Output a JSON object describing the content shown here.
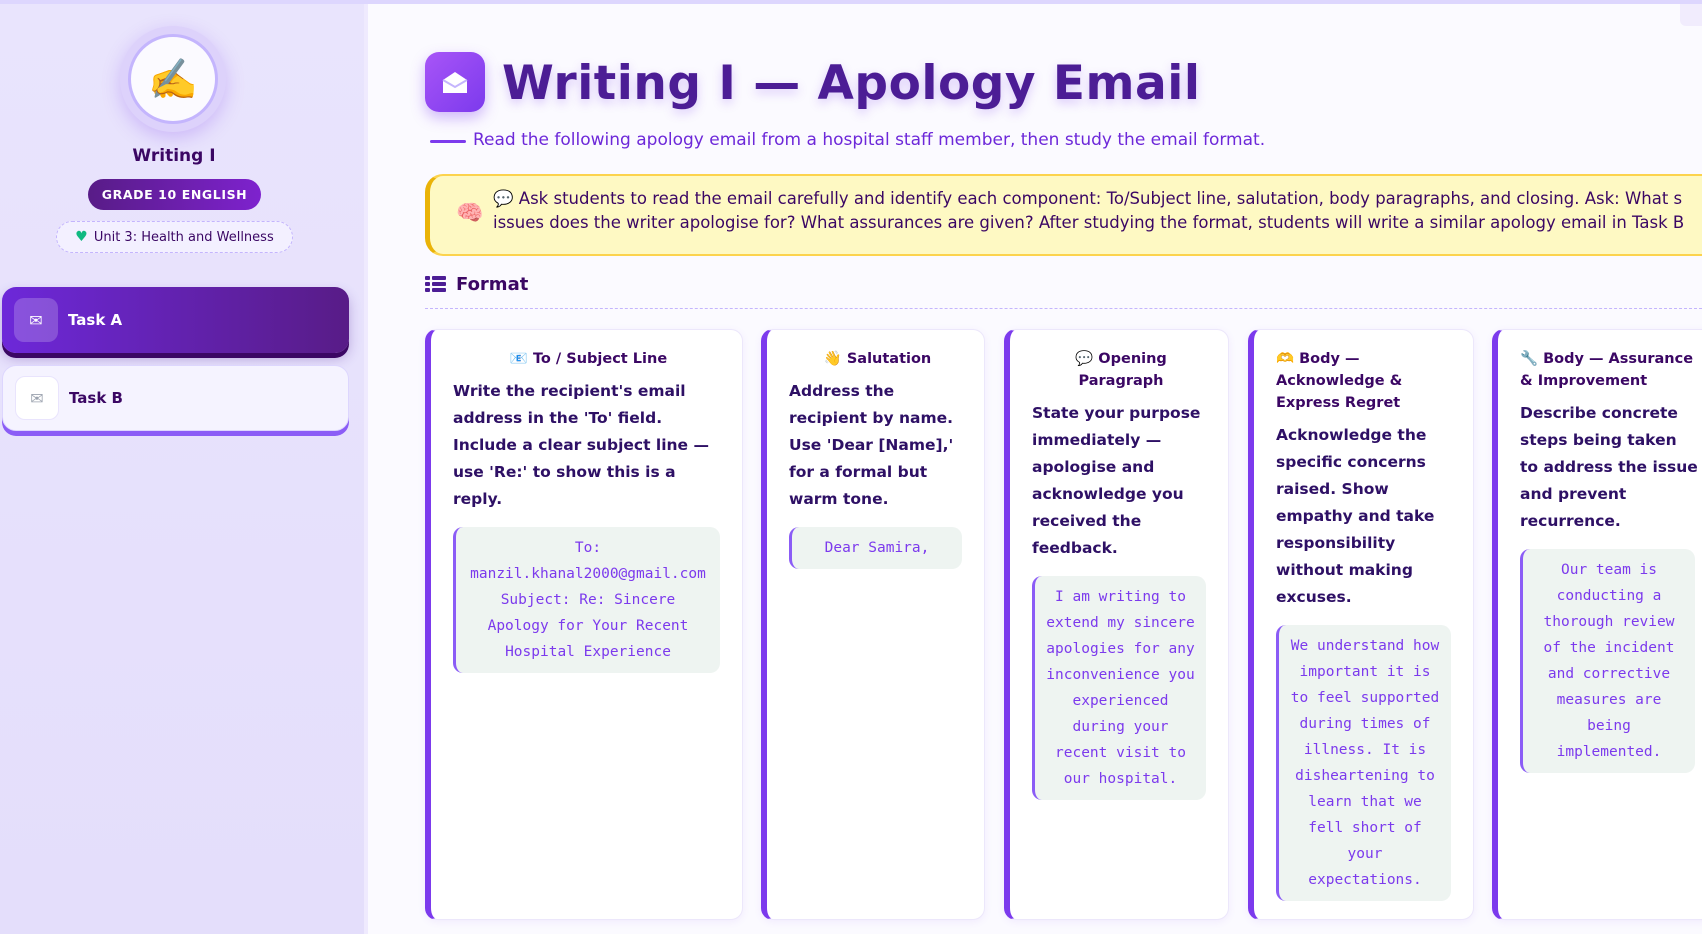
{
  "sidebar": {
    "avatar_icon": "writing-hand-icon",
    "avatar_emoji": "✍️",
    "title": "Writing I",
    "grade": "GRADE 10 ENGLISH",
    "unit": "Unit 3: Health and Wellness",
    "tasks": [
      {
        "label": "Task A",
        "icon": "email-icon",
        "glyph": "✉",
        "active": true
      },
      {
        "label": "Task B",
        "icon": "envelope-icon",
        "glyph": "✉",
        "active": false
      }
    ]
  },
  "header": {
    "icon": "envelope-open-icon",
    "title": "Writing I — Apology Email",
    "subtitle": "Read the following apology email from a hospital staff member, then study the email format."
  },
  "tip": {
    "icon": "brain-icon",
    "line1": "💬 Ask students to read the email carefully and identify each component: To/Subject line, salutation, body paragraphs, and closing. Ask: What s",
    "line2": "issues does the writer apologise for? What assurances are given? After studying the format, students will write a similar apology email in Task B"
  },
  "format": {
    "heading": "Format",
    "cards": [
      {
        "title": "📧 To / Subject Line",
        "body": "Write the recipient's email address in the 'To' field. Include a clear subject line — use 'Re:' to show this is a reply.",
        "example": "To: manzil.khanal2000@gmail.com Subject: Re: Sincere Apology for Your Recent Hospital Experience"
      },
      {
        "title": "👋 Salutation",
        "body": "Address the recipient by name. Use 'Dear [Name],' for a formal but warm tone.",
        "example": "Dear Samira,"
      },
      {
        "title": "💬 Opening Paragraph",
        "body": "State your purpose immediately — apologise and acknowledge you received the feedback.",
        "example": "I am writing to extend my sincere apologies for any inconvenience you experienced during your recent visit to our hospital."
      },
      {
        "title": "🫶 Body — Acknowledge & Express Regret",
        "body": "Acknowledge the specific concerns raised. Show empathy and take responsibility without making excuses.",
        "example": "We understand how important it is to feel supported during times of illness. It is disheartening to learn that we fell short of your expectations."
      },
      {
        "title": "🔧 Body — Assurance & Improvement",
        "body": "Describe concrete steps being taken to address the issue and prevent recurrence.",
        "example": "Our team is conducting a thorough review of the incident and corrective measures are being implemented."
      }
    ]
  }
}
